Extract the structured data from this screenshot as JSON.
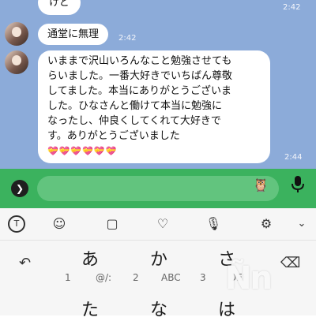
{
  "messages": [
    {
      "text": "けど",
      "time": "2:42"
    },
    {
      "text": "通堂に無理",
      "time": "2:42"
    },
    {
      "lines": [
        "いままで沢山いろんなこと勉強させても",
        "らいました。一番大好きでいちばん尊敬",
        "してました。本当にありがとうございま",
        "した。ひなさんと働けて本当に勉強に",
        "なったし、仲良くしてくれて大好きで",
        "す。ありがとうございました"
      ],
      "decoration": "💝💝💝💝💝💝",
      "time": "2:44"
    }
  ],
  "input": {
    "plus_icon": "chevron-right-icon",
    "sticker_icon": "sticker-icon",
    "mic_icon": "mic-icon"
  },
  "keyboard": {
    "toolbar": [
      "text-cursor-icon",
      "emoji-icon",
      "sticker-icon",
      "heart-icon",
      "mic-icon",
      "gear-icon",
      "chevron-down-icon"
    ],
    "row1": {
      "a": "あ",
      "ka": "か",
      "sa": "さ"
    },
    "row1_sub": {
      "a": "1",
      "ka_sym": "@/:",
      "ka": "2",
      "sa_sym": "ABC",
      "sa": "3",
      "def": "DEF"
    },
    "row2": {
      "ta": "た",
      "na": "な",
      "ha": "は"
    },
    "watermark": "Ñn"
  }
}
